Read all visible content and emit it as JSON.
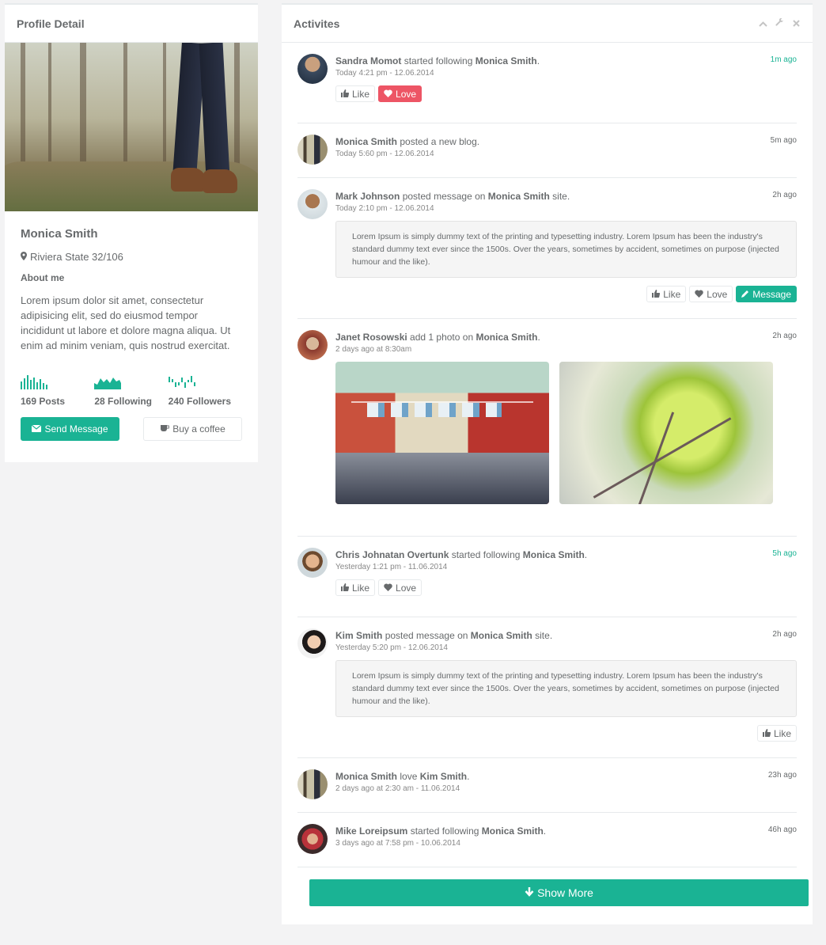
{
  "profile": {
    "title": "Profile Detail",
    "name": "Monica Smith",
    "location": "Riviera State 32/106",
    "about_heading": "About me",
    "about": "Lorem ipsum dolor sit amet, consectetur adipisicing elit, sed do eiusmod tempor incididunt ut labore et dolore magna aliqua. Ut enim ad minim veniam, quis nostrud exercitat.",
    "stats": [
      {
        "label": "169 Posts"
      },
      {
        "label": "28 Following"
      },
      {
        "label": "240 Followers"
      }
    ],
    "send_message": "Send Message",
    "buy_coffee": "Buy a coffee",
    "accent": "#1ab394"
  },
  "activity": {
    "title": "Activites",
    "items": [
      {
        "actor": "Sandra Momot",
        "verb": "started following",
        "target": "Monica Smith",
        "tail": ".",
        "when": "Today 4:21 pm - 12.06.2014",
        "ago": "1m ago",
        "like": "Like",
        "love": "Love"
      },
      {
        "actor": "Monica Smith",
        "verb": "posted a new blog.",
        "when": "Today 5:60 pm - 12.06.2014",
        "ago": "5m ago"
      },
      {
        "actor": "Mark Johnson",
        "verb": "posted message on",
        "target": "Monica Smith",
        "tail": "site.",
        "when": "Today 2:10 pm - 12.06.2014",
        "ago": "2h ago",
        "message_text": "Lorem Ipsum is simply dummy text of the printing and typesetting industry. Lorem Ipsum has been the industry's standard dummy text ever since the 1500s. Over the years, sometimes by accident, sometimes on purpose (injected humour and the like).",
        "like": "Like",
        "love": "Love",
        "message": "Message"
      },
      {
        "actor": "Janet Rosowski",
        "verb": "add 1 photo on",
        "target": "Monica Smith",
        "tail": ".",
        "when": "2 days ago at 8:30am",
        "ago": "2h ago"
      },
      {
        "actor": "Chris Johnatan Overtunk",
        "verb": "started following",
        "target": "Monica Smith",
        "tail": ".",
        "when": "Yesterday 1:21 pm - 11.06.2014",
        "ago": "5h ago",
        "like": "Like",
        "love": "Love"
      },
      {
        "actor": "Kim Smith",
        "verb": "posted message on",
        "target": "Monica Smith",
        "tail": "site.",
        "when": "Yesterday 5:20 pm - 12.06.2014",
        "ago": "2h ago",
        "message_text": "Lorem Ipsum is simply dummy text of the printing and typesetting industry. Lorem Ipsum has been the industry's standard dummy text ever since the 1500s. Over the years, sometimes by accident, sometimes on purpose (injected humour and the like).",
        "like": "Like"
      },
      {
        "actor": "Monica Smith",
        "verb": "love",
        "target": "Kim Smith",
        "tail": ".",
        "when": "2 days ago at 2:30 am - 11.06.2014",
        "ago": "23h ago"
      },
      {
        "actor": "Mike Loreipsum",
        "verb": "started following",
        "target": "Monica Smith",
        "tail": ".",
        "when": "3 days ago at 7:58 pm - 10.06.2014",
        "ago": "46h ago"
      }
    ],
    "show_more": "Show More"
  }
}
